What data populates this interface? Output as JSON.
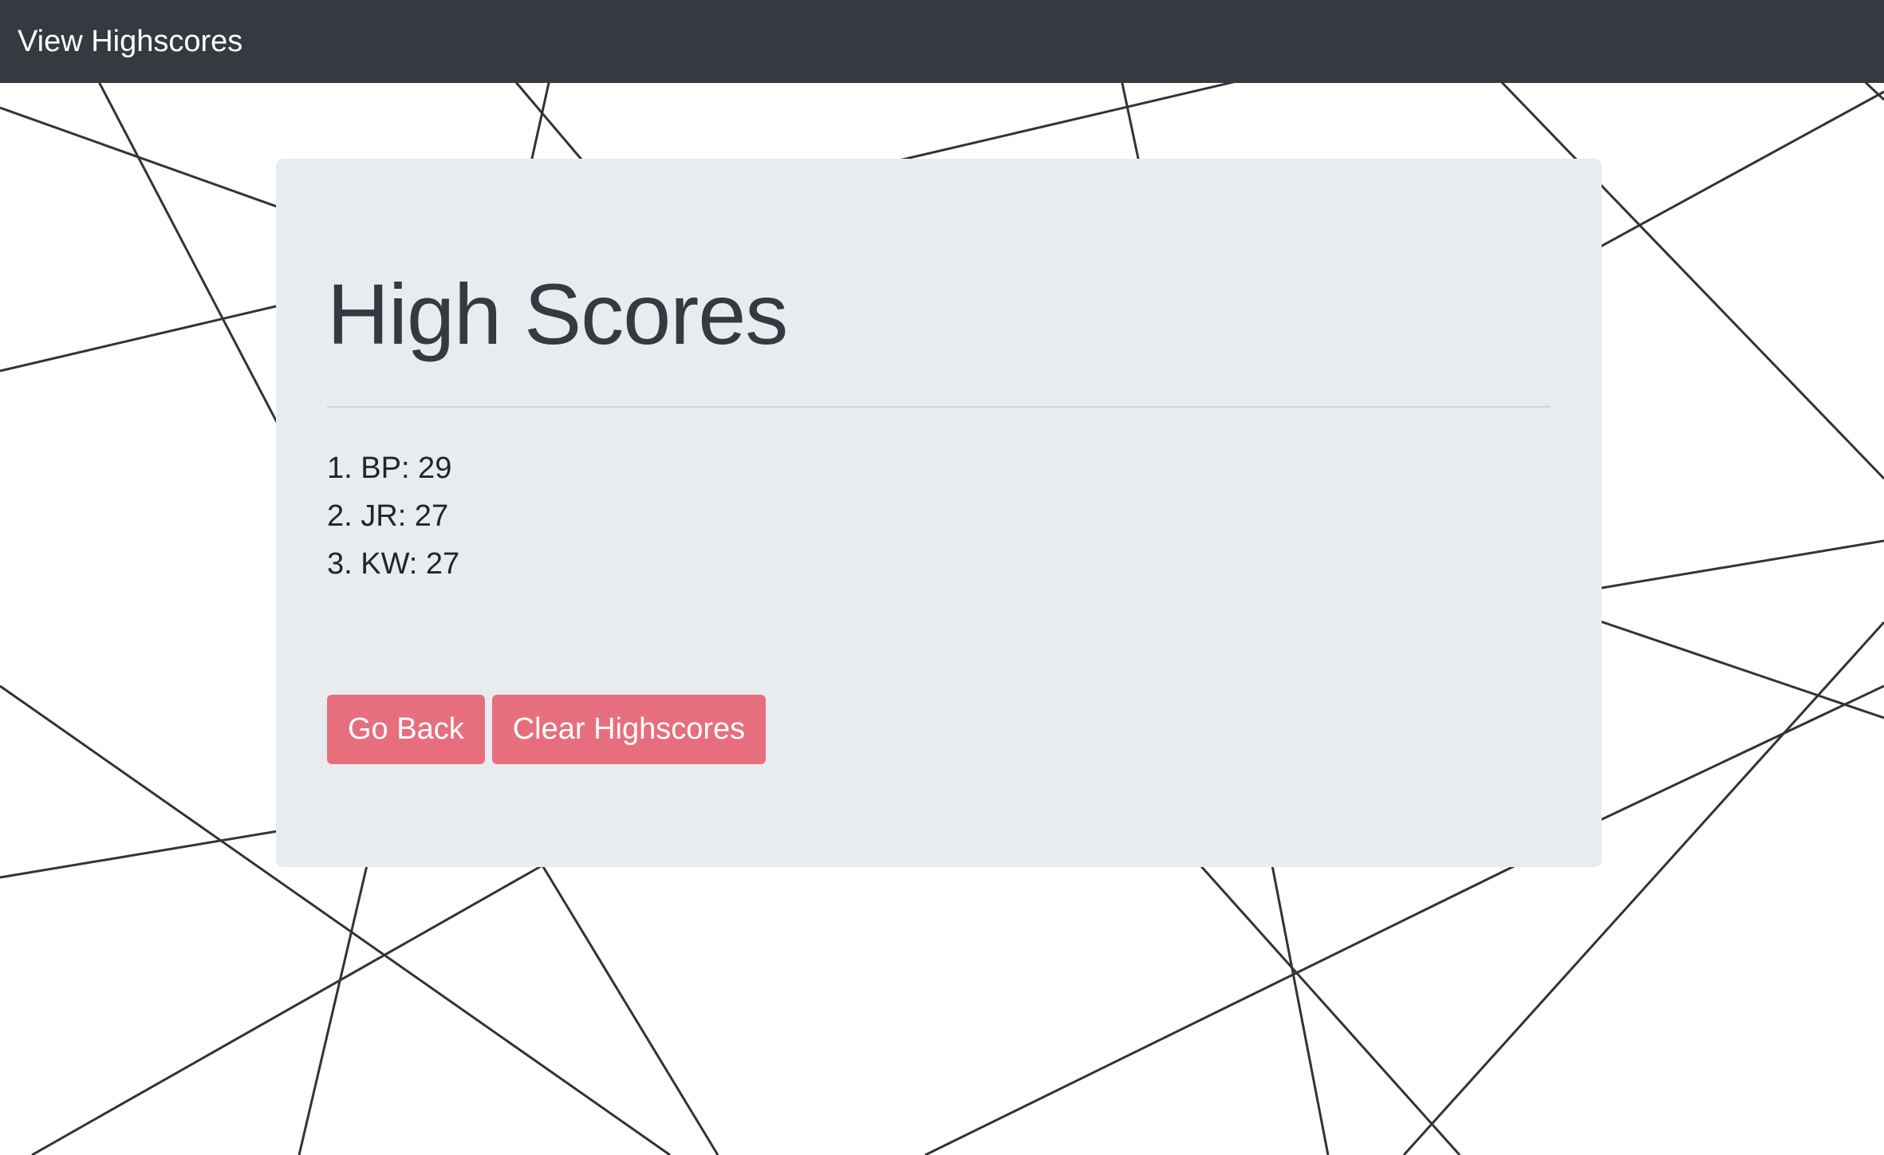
{
  "navbar": {
    "link_label": "View Highscores"
  },
  "card": {
    "title": "High Scores",
    "scores": [
      "1. BP: 29",
      "2. JR: 27",
      "3. KW: 27"
    ],
    "buttons": {
      "go_back": "Go Back",
      "clear": "Clear Highscores"
    }
  },
  "colors": {
    "navbar_bg": "#343a40",
    "card_bg": "#e9ecef",
    "button_bg": "#e76f7d",
    "line_color": "#333333"
  }
}
